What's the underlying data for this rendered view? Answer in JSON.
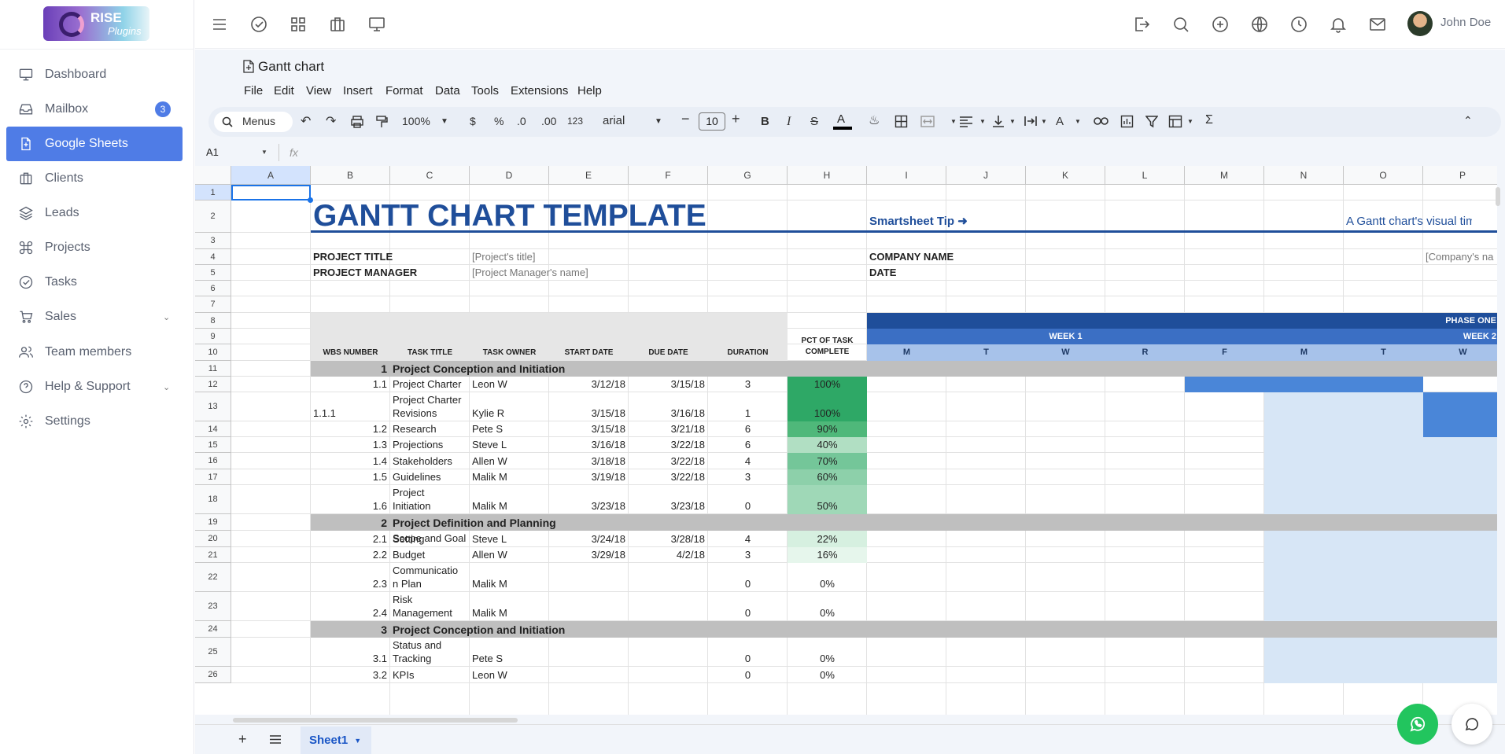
{
  "brand": {
    "name": "RISE",
    "tagline": "Plugins"
  },
  "sidebar": {
    "items": [
      {
        "label": "Dashboard",
        "icon": "monitor-icon"
      },
      {
        "label": "Mailbox",
        "icon": "inbox-icon",
        "badge": "3"
      },
      {
        "label": "Google Sheets",
        "icon": "file-icon",
        "active": true
      },
      {
        "label": "Clients",
        "icon": "briefcase-icon"
      },
      {
        "label": "Leads",
        "icon": "layers-icon"
      },
      {
        "label": "Projects",
        "icon": "command-icon"
      },
      {
        "label": "Tasks",
        "icon": "check-circle-icon"
      },
      {
        "label": "Sales",
        "icon": "cart-icon",
        "expandable": true
      },
      {
        "label": "Team members",
        "icon": "users-icon"
      },
      {
        "label": "Help & Support",
        "icon": "help-icon",
        "expandable": true
      },
      {
        "label": "Settings",
        "icon": "settings-icon"
      }
    ]
  },
  "user": {
    "name": "John Doe"
  },
  "document": {
    "title": "Gantt chart"
  },
  "menubar": [
    "File",
    "Edit",
    "View",
    "Insert",
    "Format",
    "Data",
    "Tools",
    "Extensions",
    "Help"
  ],
  "toolbar": {
    "search_label": "Menus",
    "zoom": "100%",
    "currency": "$",
    "percent": "%",
    "dec_less": ".0",
    "dec_more": ".00",
    "number_format": "123",
    "font": "arial",
    "font_size": "10"
  },
  "formula_bar": {
    "cell_ref": "A1",
    "fx": "fx"
  },
  "columns": [
    "A",
    "B",
    "C",
    "D",
    "E",
    "F",
    "G",
    "H",
    "I",
    "J",
    "K",
    "L",
    "M",
    "N",
    "O",
    "P"
  ],
  "rows": [
    "1",
    "2",
    "3",
    "4",
    "5",
    "6",
    "7",
    "8",
    "9",
    "10",
    "11",
    "12",
    "13",
    "14",
    "15",
    "16",
    "17",
    "18",
    "19",
    "20",
    "21",
    "22",
    "23",
    "24",
    "25",
    "26"
  ],
  "sheet": {
    "title": "GANTT CHART TEMPLATE",
    "tip": "Smartsheet Tip ➜",
    "tip_text": "A Gantt chart's visual timel",
    "project_title_label": "PROJECT TITLE",
    "project_title_value": "[Project's title]",
    "project_manager_label": "PROJECT MANAGER",
    "project_manager_value": "[Project Manager's name]",
    "company_label": "COMPANY NAME",
    "company_value": "[Company's na",
    "date_label": "DATE",
    "phase": "PHASE ONE",
    "week1": "WEEK 1",
    "week2": "WEEK 2",
    "days": [
      "M",
      "T",
      "W",
      "R",
      "F",
      "M",
      "T",
      "W"
    ],
    "headers": {
      "wbs": "WBS NUMBER",
      "title": "TASK TITLE",
      "owner": "TASK OWNER",
      "start": "START DATE",
      "due": "DUE DATE",
      "duration": "DURATION",
      "pct1": "PCT OF TASK",
      "pct2": "COMPLETE"
    },
    "tasks": [
      {
        "wbs": "1",
        "title": "Project Conception and Initiation",
        "section": true
      },
      {
        "wbs": "1.1",
        "title": "Project Charter",
        "owner": "Leon W",
        "start": "3/12/18",
        "due": "3/15/18",
        "dur": "3",
        "pct": "100%"
      },
      {
        "wbs": "1.1.1",
        "title": "Project Charter",
        "title2": "Revisions",
        "owner": "Kylie R",
        "start": "3/15/18",
        "due": "3/16/18",
        "dur": "1",
        "pct": "100%"
      },
      {
        "wbs": "1.2",
        "title": "Research",
        "owner": "Pete S",
        "start": "3/15/18",
        "due": "3/21/18",
        "dur": "6",
        "pct": "90%"
      },
      {
        "wbs": "1.3",
        "title": "Projections",
        "owner": "Steve L",
        "start": "3/16/18",
        "due": "3/22/18",
        "dur": "6",
        "pct": "40%"
      },
      {
        "wbs": "1.4",
        "title": "Stakeholders",
        "owner": "Allen W",
        "start": "3/18/18",
        "due": "3/22/18",
        "dur": "4",
        "pct": "70%"
      },
      {
        "wbs": "1.5",
        "title": "Guidelines",
        "owner": "Malik M",
        "start": "3/19/18",
        "due": "3/22/18",
        "dur": "3",
        "pct": "60%"
      },
      {
        "wbs": "1.6",
        "title": "Project",
        "title2": "Initiation",
        "owner": "Malik M",
        "start": "3/23/18",
        "due": "3/23/18",
        "dur": "0",
        "pct": "50%"
      },
      {
        "wbs": "2",
        "title": "Project Definition and Planning",
        "section": true
      },
      {
        "wbs": "2.1",
        "title": "Scope and Goal",
        "title2": "Setting",
        "owner": "Steve L",
        "start": "3/24/18",
        "due": "3/28/18",
        "dur": "4",
        "pct": "22%"
      },
      {
        "wbs": "2.2",
        "title": "Budget",
        "owner": "Allen W",
        "start": "3/29/18",
        "due": "4/2/18",
        "dur": "3",
        "pct": "16%"
      },
      {
        "wbs": "2.3",
        "title": "Communicatio",
        "title2": "n Plan",
        "owner": "Malik M",
        "start": "",
        "due": "",
        "dur": "0",
        "pct": "0%"
      },
      {
        "wbs": "2.4",
        "title": "Risk",
        "title2": "Management",
        "owner": "Malik M",
        "start": "",
        "due": "",
        "dur": "0",
        "pct": "0%"
      },
      {
        "wbs": "3",
        "title": "Project Conception and Initiation",
        "section": true
      },
      {
        "wbs": "3.1",
        "title": "Status and",
        "title2": "Tracking",
        "owner": "Pete S",
        "start": "",
        "due": "",
        "dur": "0",
        "pct": "0%"
      },
      {
        "wbs": "3.2",
        "title": "KPIs",
        "owner": "Leon W",
        "start": "",
        "due": "",
        "dur": "0",
        "pct": "0%"
      }
    ]
  },
  "sheet_tab": "Sheet1",
  "colors": {
    "accent": "#4f7ce6",
    "title_blue": "#1f4e9a",
    "phase_dark": "#1f4e9a",
    "week": "#3b6fc4",
    "day": "#a7c2ea",
    "bar": "#4a86d8",
    "light_bar": "#d7e6f6",
    "section_gray": "#bfbfbf",
    "green": "#23a95f"
  }
}
